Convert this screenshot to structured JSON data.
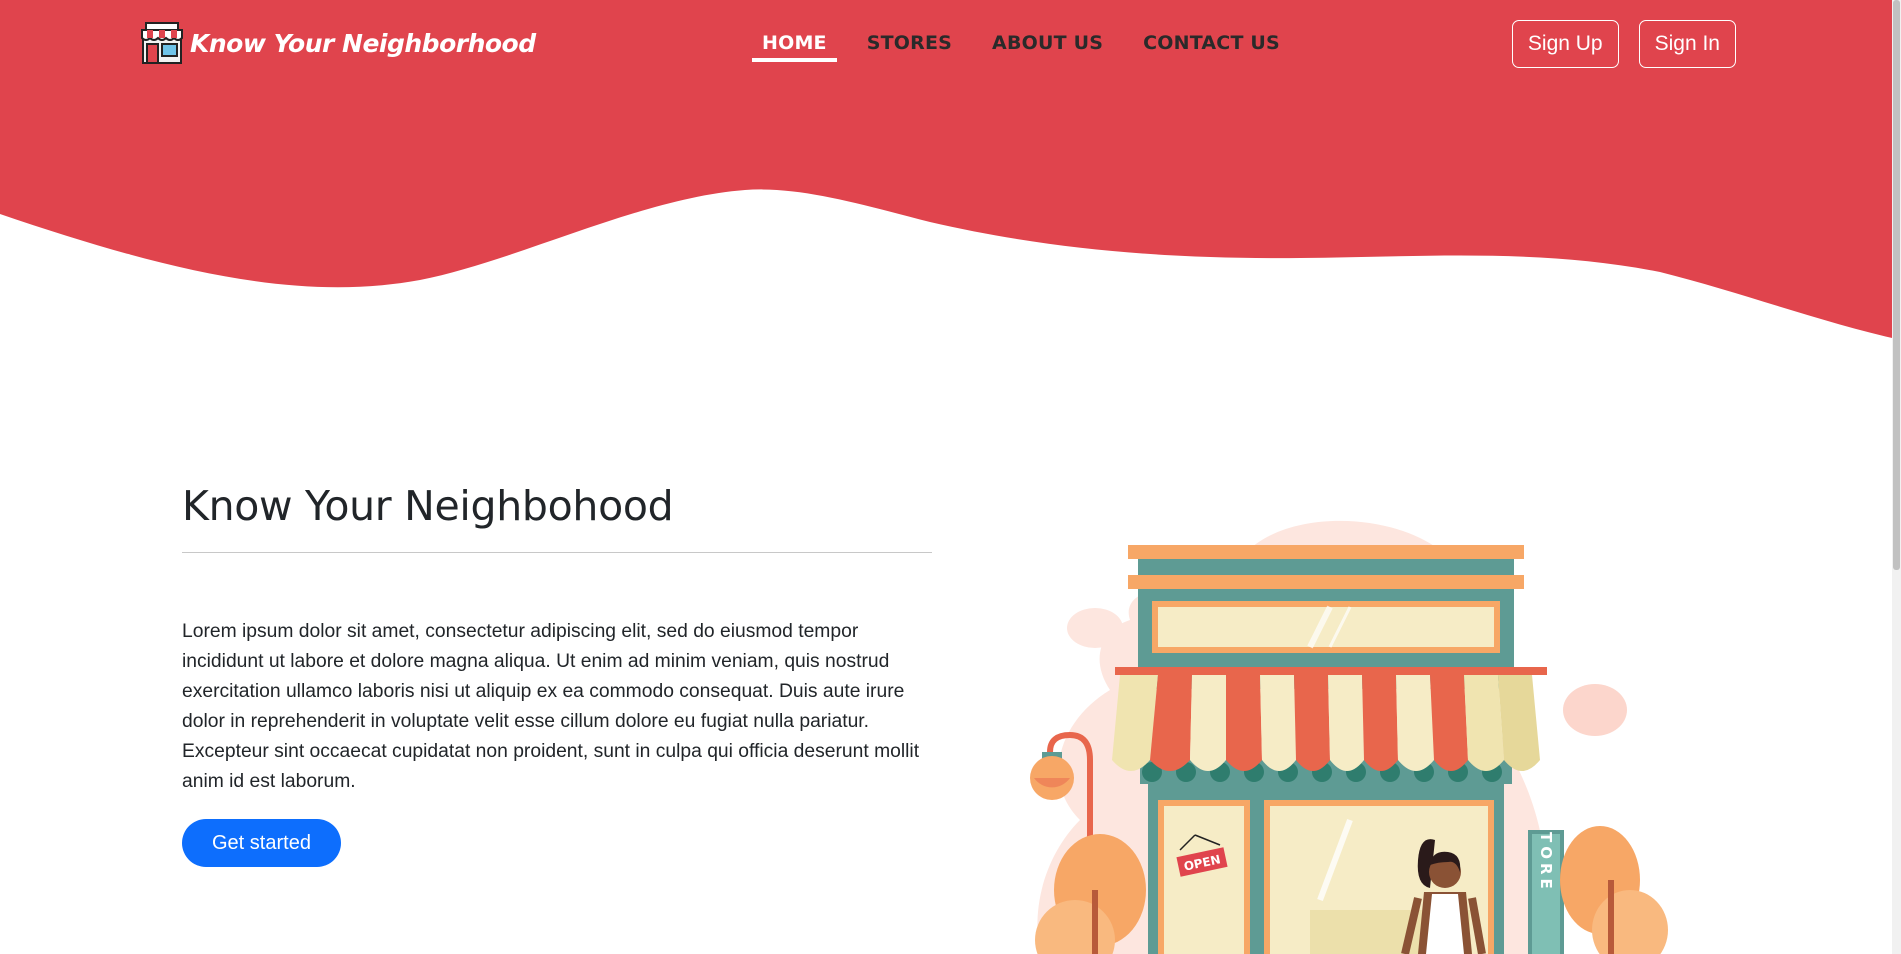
{
  "brand": {
    "name": "Know Your Neighborhood",
    "icon": "storefront-icon"
  },
  "nav": [
    {
      "label": "HOME",
      "active": true
    },
    {
      "label": "STORES",
      "active": false
    },
    {
      "label": "ABOUT US",
      "active": false
    },
    {
      "label": "CONTACT US",
      "active": false
    }
  ],
  "auth": {
    "signup": "Sign Up",
    "signin": "Sign In"
  },
  "hero": {
    "title": "Know Your Neighbohood",
    "paragraph": "Lorem ipsum dolor sit amet, consectetur adipiscing elit, sed do eiusmod tempor incididunt ut labore et dolore magna aliqua. Ut enim ad minim veniam, quis nostrud exercitation ullamco laboris nisi ut aliquip ex ea commodo consequat. Duis aute irure dolor in reprehenderit in voluptate velit esse cillum dolore eu fugiat nulla pariatur. Excepteur sint occaecat cupidatat non proident, sunt in culpa qui officia deserunt mollit anim id est laborum.",
    "cta": "Get started"
  },
  "illustration": {
    "sign_open": "OPEN",
    "sign_store": "STORE"
  },
  "colors": {
    "primary_red": "#e0444d",
    "accent_blue": "#0d6efd",
    "text_dark": "#212529"
  }
}
